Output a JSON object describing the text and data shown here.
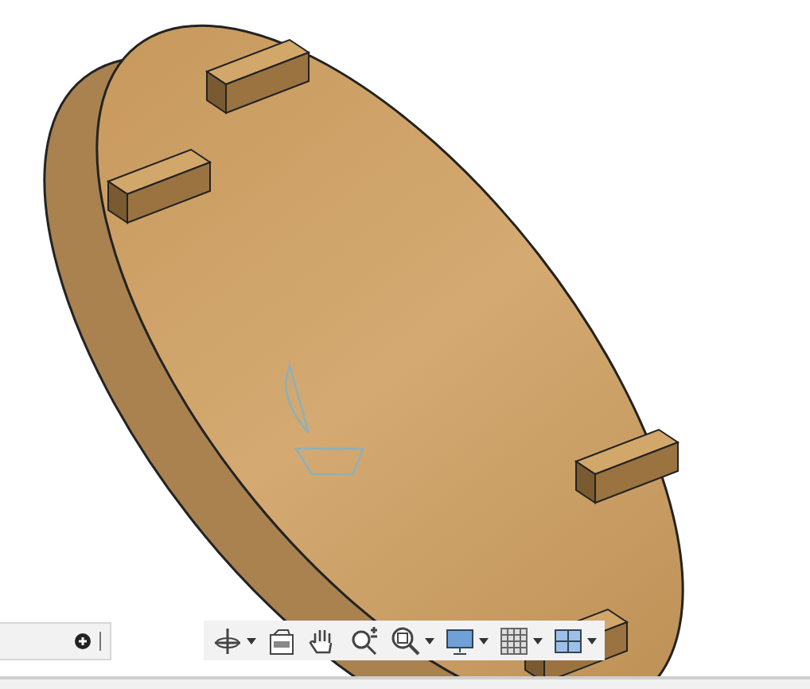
{
  "navigation_toolbar": [
    {
      "kind": "orbit",
      "dropdown": true
    },
    {
      "kind": "look-at",
      "dropdown": false
    },
    {
      "kind": "pan",
      "dropdown": false
    },
    {
      "kind": "zoom",
      "dropdown": false
    },
    {
      "kind": "fit",
      "dropdown": true
    },
    {
      "kind": "display",
      "dropdown": true
    },
    {
      "kind": "grid",
      "dropdown": true
    },
    {
      "kind": "viewports",
      "dropdown": true
    }
  ]
}
